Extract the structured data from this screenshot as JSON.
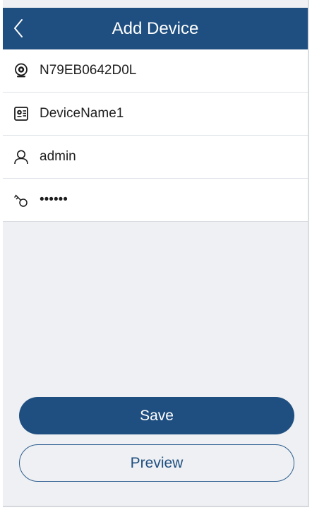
{
  "header": {
    "title": "Add Device",
    "back_icon": "chevron-left-icon"
  },
  "form": {
    "fields": [
      {
        "icon": "camera-icon",
        "value": "N79EB0642D0L",
        "type": "text"
      },
      {
        "icon": "device-card-icon",
        "value": "DeviceName1",
        "type": "text"
      },
      {
        "icon": "user-icon",
        "value": "admin",
        "type": "text"
      },
      {
        "icon": "key-icon",
        "value": "••••••",
        "type": "password"
      }
    ]
  },
  "buttons": {
    "save_label": "Save",
    "preview_label": "Preview"
  },
  "colors": {
    "brand": "#1f4f80",
    "background": "#eef0f3",
    "text": "#1e1e1e"
  }
}
